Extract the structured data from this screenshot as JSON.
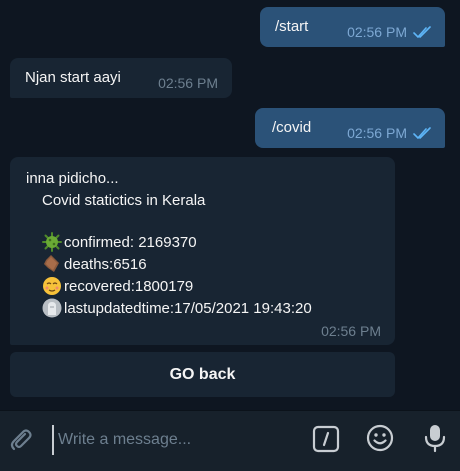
{
  "messages": [
    {
      "text": "/start",
      "time": "02:56 PM"
    },
    {
      "text": "Njan start aayi",
      "time": "02:56 PM"
    },
    {
      "text": "/covid",
      "time": "02:56 PM"
    }
  ],
  "bot_reply": {
    "line1": "inna pidicho...",
    "line2": "Covid statictics in Kerala",
    "confirmed": "confirmed: 2169370",
    "deaths": "deaths:6516",
    "recovered": "recovered:1800179",
    "updated": "lastupdatedtime:17/05/2021 19:43:20",
    "time": "02:56 PM"
  },
  "keyboard": {
    "go_back_label": "GO back"
  },
  "composer": {
    "placeholder": "Write a message..."
  },
  "colors": {
    "background": "#0e1621",
    "outgoing_bubble": "#2b5278",
    "incoming_bubble": "#182533",
    "composer_bar": "#17212b",
    "check_marks": "#5eb5f7"
  },
  "icons": [
    "double-check-icon",
    "virus-icon",
    "coffin-icon",
    "relieved-face-icon",
    "headstone-icon",
    "paperclip-icon",
    "command-slash-icon",
    "smiley-icon",
    "microphone-icon"
  ]
}
